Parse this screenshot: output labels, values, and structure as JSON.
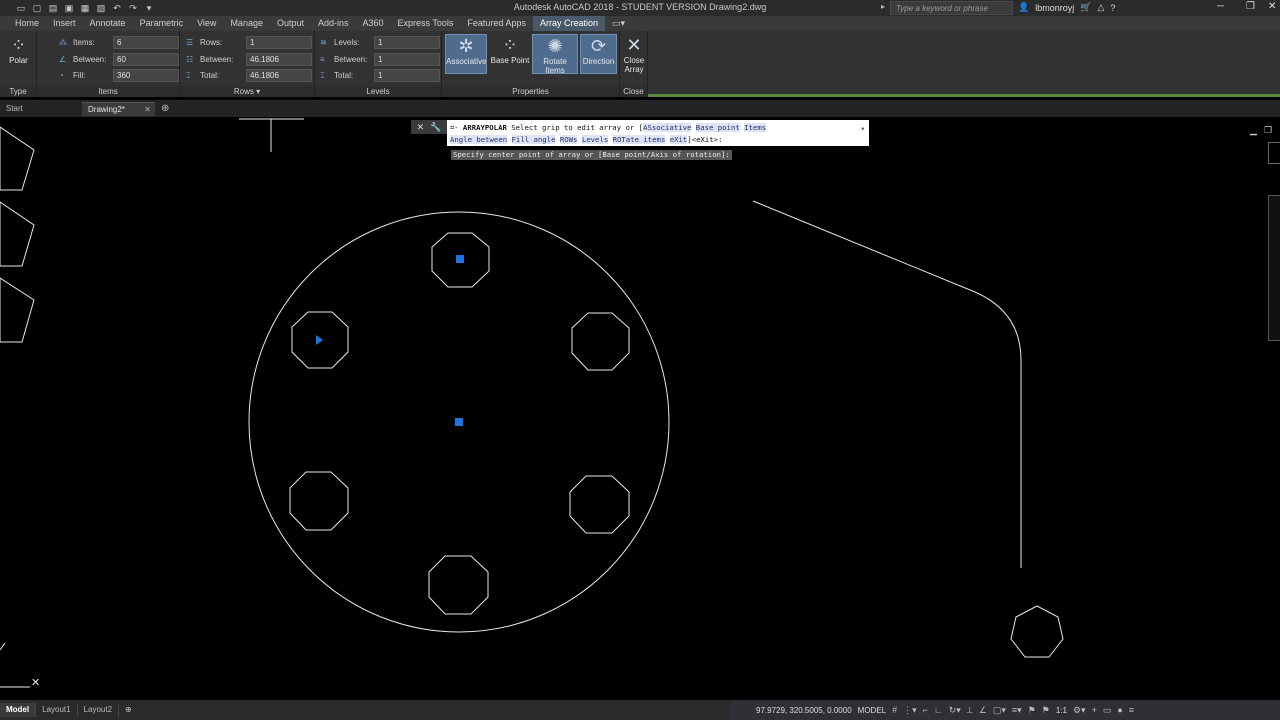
{
  "app": {
    "title": "Autodesk AutoCAD 2018 - STUDENT VERSION    Drawing2.dwg"
  },
  "search": {
    "placeholder": "Type a keyword or phrase"
  },
  "user": {
    "name": "lbmonroyj"
  },
  "ribbon_tabs": [
    "Home",
    "Insert",
    "Annotate",
    "Parametric",
    "View",
    "Manage",
    "Output",
    "Add-ins",
    "A360",
    "Express Tools",
    "Featured Apps",
    "Array Creation"
  ],
  "panels": {
    "type": {
      "title": "Type",
      "button": "Polar"
    },
    "items": {
      "title": "Items",
      "items_label": "Items:",
      "items_value": "6",
      "between_label": "Between:",
      "between_value": "60",
      "fill_label": "Fill:",
      "fill_value": "360"
    },
    "rows": {
      "title": "Rows",
      "rows_label": "Rows:",
      "rows_value": "1",
      "between_label": "Between:",
      "between_value": "46.1806",
      "total_label": "Total:",
      "total_value": "46.1806"
    },
    "levels": {
      "title": "Levels",
      "levels_label": "Levels:",
      "levels_value": "1",
      "between_label": "Between:",
      "between_value": "1",
      "total_label": "Total:",
      "total_value": "1"
    },
    "properties": {
      "title": "Properties",
      "associative": "Associative",
      "base_point": "Base Point",
      "rotate_items": "Rotate Items",
      "direction": "Direction"
    },
    "close": {
      "title": "Close",
      "label1": "Close",
      "label2": "Array"
    }
  },
  "file_tabs": {
    "start": "Start",
    "drawing": "Drawing2*"
  },
  "command": {
    "name": "ARRAYPOLAR",
    "line1_text": "Select grip to edit array or [",
    "opt_as": "ASsociative",
    "opt_base": "Base point",
    "opt_items": "Items",
    "opt_angle": "Angle between",
    "opt_fill": "Fill angle",
    "opt_rows": "ROWs",
    "opt_levels": "Levels",
    "opt_rotate": "ROTate items",
    "opt_exit": "eXit",
    "line2_suffix": "]<eXit>:",
    "prompt": "Specify center point of array or [Base point/Axis of rotation]:"
  },
  "layout_tabs": [
    "Model",
    "Layout1",
    "Layout2"
  ],
  "status": {
    "coords": "97.9729, 320.5005, 0.0000",
    "space": "MODEL",
    "scale": "1:1"
  }
}
